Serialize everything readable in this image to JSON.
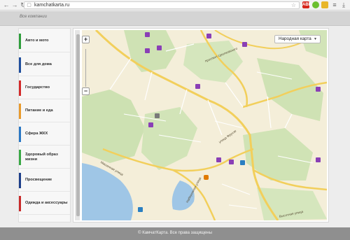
{
  "browser": {
    "url": "kamchatkarta.ru",
    "back_icon": "arrow-left-icon",
    "forward_icon": "arrow-right-icon",
    "reload_icon": "reload-icon",
    "page_icon": "page-icon",
    "star_icon": "star-icon",
    "extensions": [
      {
        "name": "abp-extension-icon",
        "label": "ABP"
      },
      {
        "name": "green-extension-icon",
        "label": ""
      },
      {
        "name": "yellow-extension-icon",
        "label": ""
      }
    ],
    "menu_icon": "menu-icon",
    "download_icon": "download-icon"
  },
  "breadcrumb": "Все компании",
  "sidebar": {
    "items": [
      {
        "label": "Авто и мото",
        "color": "#2e9d3b"
      },
      {
        "label": "Все для дома",
        "color": "#1f4e9c"
      },
      {
        "label": "Государство",
        "color": "#d32a2a"
      },
      {
        "label": "Питание и еда",
        "color": "#e89a2c"
      },
      {
        "label": "Сфера ЖКХ",
        "color": "#2a77c4"
      },
      {
        "label": "Здоровый образ жизни",
        "color": "#39a845"
      },
      {
        "label": "Просвещение",
        "color": "#1d3f8a"
      },
      {
        "label": "Одежда и аксессуары",
        "color": "#c82a2a"
      }
    ]
  },
  "map": {
    "zoom_in": "+",
    "zoom_out": "−",
    "map_type": "Народная карта",
    "streets": [
      "проспект Циолковского",
      "улица Фрунзе",
      "Мишенная улица",
      "Набережная улица",
      "Высотная улица"
    ]
  },
  "footer": "© КамчатКарта. Все права защищены"
}
